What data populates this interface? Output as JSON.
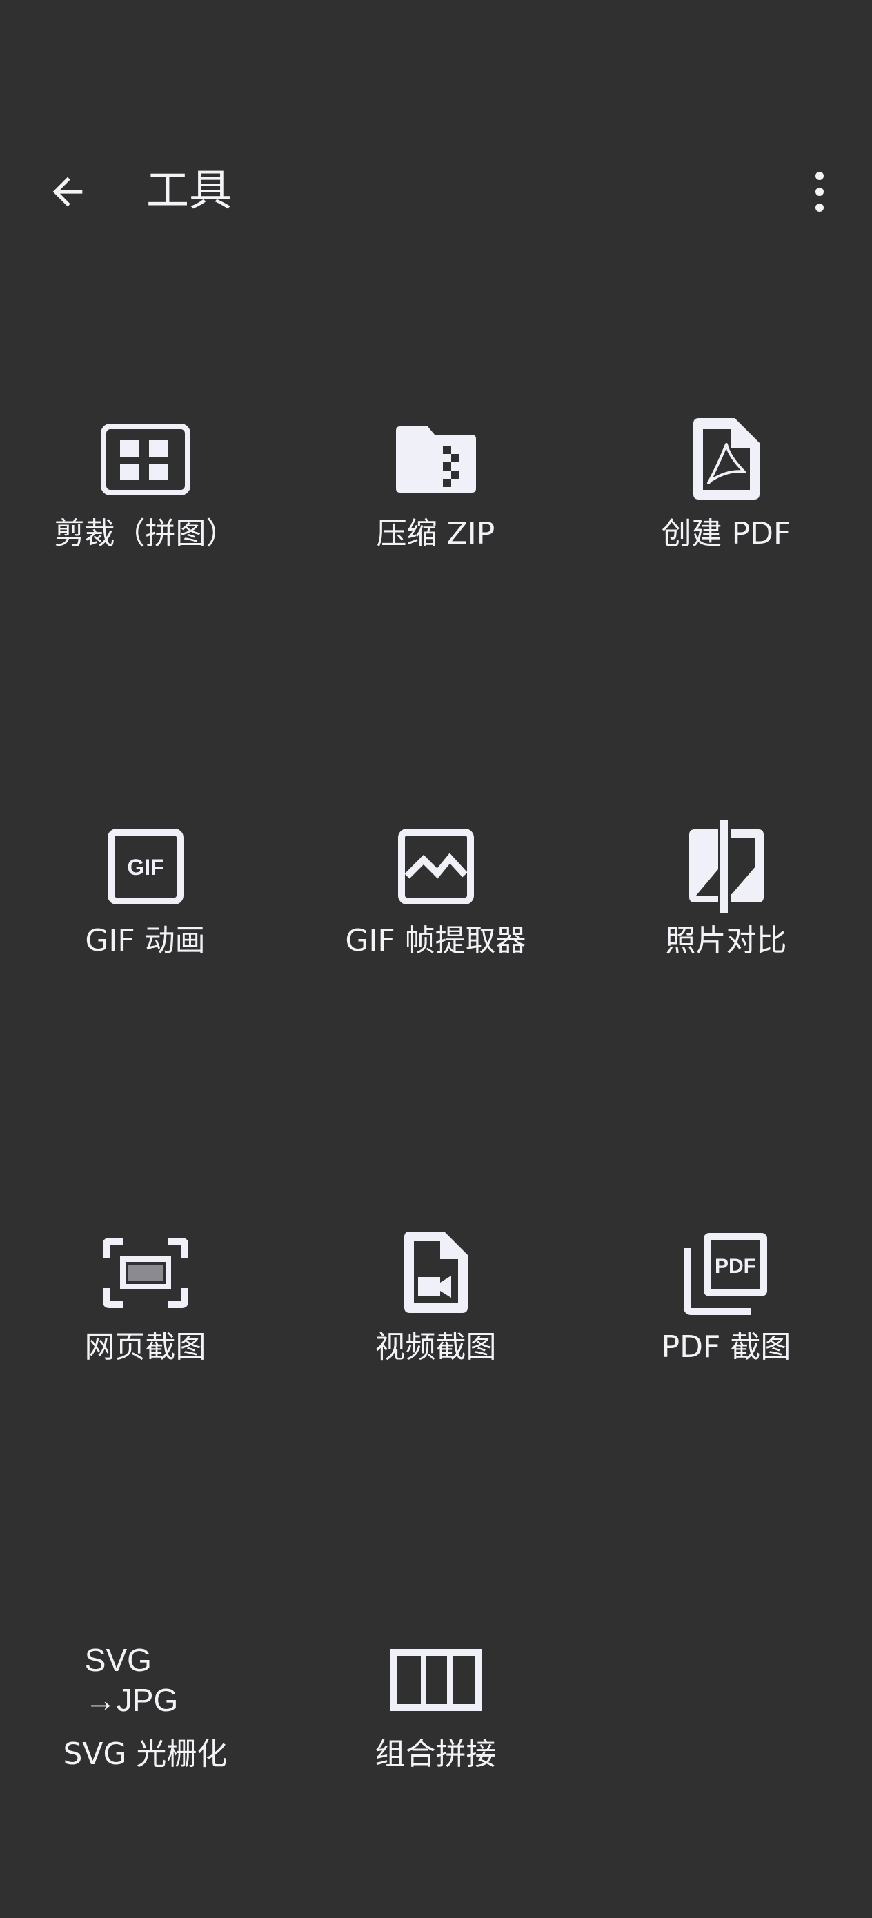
{
  "header": {
    "title": "工具"
  },
  "tools": [
    {
      "label": "剪裁（拼图）",
      "icon": "grid-crop-icon"
    },
    {
      "label": "压缩 ZIP",
      "icon": "zip-folder-icon"
    },
    {
      "label": "创建 PDF",
      "icon": "pdf-file-icon"
    },
    {
      "label": "GIF 动画",
      "icon": "gif-icon"
    },
    {
      "label": "GIF 帧提取器",
      "icon": "image-frame-icon"
    },
    {
      "label": "照片对比",
      "icon": "compare-icon"
    },
    {
      "label": "网页截图",
      "icon": "screenshot-icon"
    },
    {
      "label": "视频截图",
      "icon": "video-file-icon"
    },
    {
      "label": "PDF 截图",
      "icon": "pdf-stack-icon"
    },
    {
      "label": "SVG 光栅化",
      "icon": "svg-to-jpg-icon",
      "icon_text": [
        "SVG",
        "→JPG"
      ]
    },
    {
      "label": "组合拼接",
      "icon": "columns-icon"
    }
  ]
}
